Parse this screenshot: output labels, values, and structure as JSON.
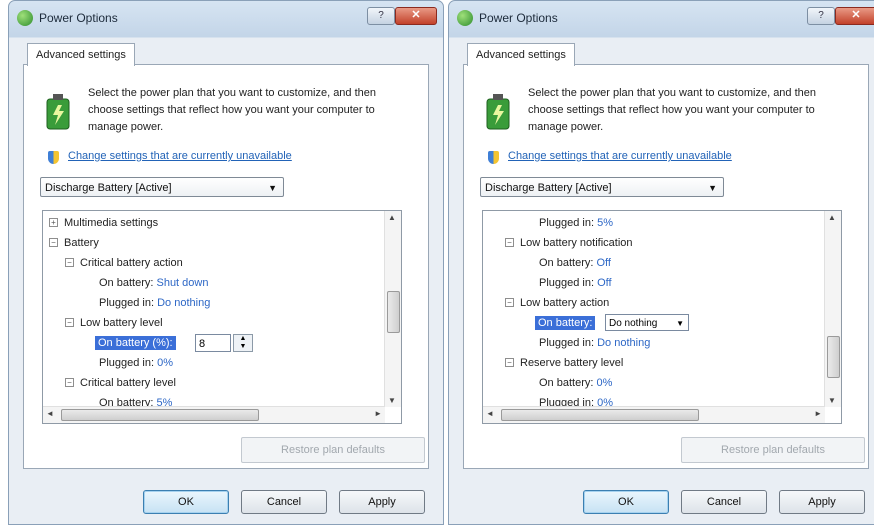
{
  "windows": [
    {
      "title": "Power Options",
      "tab": "Advanced settings",
      "intro": "Select the power plan that you want to customize, and then choose settings that reflect how you want your computer to manage power.",
      "change_link": "Change settings that are currently unavailable",
      "plan": "Discharge Battery [Active]",
      "tree": {
        "multimedia": "Multimedia settings",
        "battery": "Battery",
        "critical_action": "Critical battery action",
        "on_battery_label": "On battery:",
        "on_battery_value": "Shut down",
        "plugged_in_label": "Plugged in:",
        "plugged_in_value": "Do nothing",
        "low_level": "Low battery level",
        "low_on_battery": "On battery (%):",
        "low_spin_value": "8",
        "low_plugged_label": "Plugged in:",
        "low_plugged_value": "0%",
        "critical_level": "Critical battery level",
        "crit_on_battery_label": "On battery:",
        "crit_on_battery_value": "5%"
      },
      "restore": "Restore plan defaults",
      "ok": "OK",
      "cancel": "Cancel",
      "apply": "Apply"
    },
    {
      "title": "Power Options",
      "tab": "Advanced settings",
      "intro": "Select the power plan that you want to customize, and then choose settings that reflect how you want your computer to manage power.",
      "change_link": "Change settings that are currently unavailable",
      "plan": "Discharge Battery [Active]",
      "tree": {
        "plugged_in_label": "Plugged in:",
        "plugged_in_value": "5%",
        "low_notification": "Low battery notification",
        "notif_on_label": "On battery:",
        "notif_on_value": "Off",
        "notif_plugged_label": "Plugged in:",
        "notif_plugged_value": "Off",
        "low_action": "Low battery action",
        "action_on_label": "On battery:",
        "action_on_value": "Do nothing",
        "action_plugged_label": "Plugged in:",
        "action_plugged_value": "Do nothing",
        "reserve": "Reserve battery level",
        "reserve_on_label": "On battery:",
        "reserve_on_value": "0%",
        "reserve_plugged_label": "Plugged in:",
        "reserve_plugged_value": "0%"
      },
      "restore": "Restore plan defaults",
      "ok": "OK",
      "cancel": "Cancel",
      "apply": "Apply"
    }
  ],
  "icons": {
    "app": "power-options-icon",
    "plan": "battery-plan-icon",
    "shield": "uac-shield-icon"
  }
}
